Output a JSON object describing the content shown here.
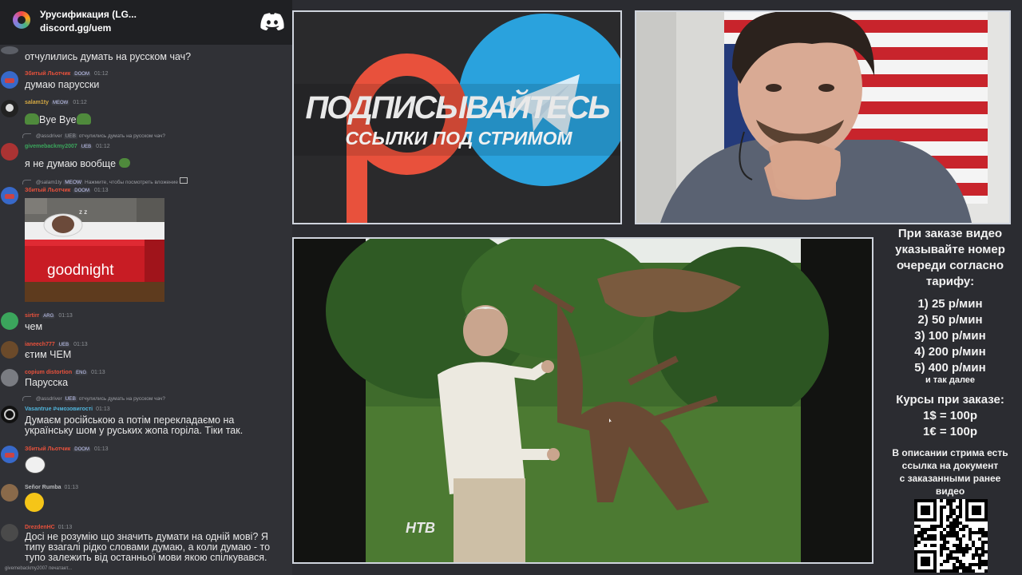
{
  "chat": {
    "server": {
      "name": "Урусификация (LG...",
      "invite": "discord.gg/uem",
      "discord_icon": "discord-logo-icon"
    },
    "messages": [
      {
        "text": "отчулились думать на русском чач?"
      },
      {
        "author": "Збитый Льотчик",
        "author_color": "#e8513c",
        "badge": "DOOM",
        "time": "01:12",
        "text": "думаю парусски"
      },
      {
        "author": "salam1ty",
        "author_color": "#d4a843",
        "badge": "MEOW",
        "time": "01:12",
        "text": "Bye Bye"
      },
      {
        "reply_to": "@assdriver",
        "reply_badge": "UEB",
        "reply_text": "отчулились думать на русском чач?",
        "author": "givemebackmy2007",
        "author_color": "#3ba55c",
        "badge": "UEB",
        "time": "01:12",
        "text": "я не думаю вообще"
      },
      {
        "reply_to": "@salam1ty",
        "reply_badge": "MEOW",
        "reply_text": "Нажмите, чтобы посмотреть вложение",
        "author": "Збитый Льотчик",
        "author_color": "#e8513c",
        "badge": "DOOM",
        "time": "01:13",
        "image_caption": "goodnight"
      },
      {
        "author": "sirtirr",
        "author_color": "#e8513c",
        "badge": "ARG",
        "time": "01:13",
        "text": "чем"
      },
      {
        "author": "ianeech777",
        "author_color": "#e8513c",
        "badge": "UEB",
        "time": "01:13",
        "text": "єтим ЧЕМ"
      },
      {
        "author": "copium distortion",
        "author_color": "#e8513c",
        "badge": "ENG",
        "time": "01:13",
        "text": "Парусска"
      },
      {
        "reply_to": "@assdriver",
        "reply_badge": "UEB",
        "reply_text": "отчулились думать на русском чач?",
        "author": "Vasantrue #чмозовигості",
        "author_color": "#4fb3d9",
        "time": "01:13",
        "text_lines": [
          "Думаєм російською а потім перекладаємо на",
          "українську шом у руських жопа горіла. Тіки так."
        ]
      },
      {
        "author": "Збитый Льотчик",
        "author_color": "#e8513c",
        "badge": "DOOM",
        "time": "01:13"
      },
      {
        "author": "Señor Rumba",
        "author_color": "#b9bbbe",
        "time": "01:13"
      },
      {
        "author": "DrezdenHC",
        "author_color": "#e8513c",
        "time": "01:13",
        "text_lines": [
          "Досі не розумію що значить думати на одній мові? Я",
          "типу взагалі рідко словами думаю, а коли думаю - то",
          "тупо залежить від останньої мови якою спілкувався."
        ]
      }
    ],
    "typing": "givemebackmy2007 печатает..."
  },
  "promo": {
    "title": "ПОДПИСЫВАЙТЕСЬ",
    "subtitle": "ССЫЛКИ ПОД СТРИМОМ",
    "icons": [
      "patreon-logo-icon",
      "telegram-logo-icon"
    ]
  },
  "video": {
    "watermark": "НТВ"
  },
  "info": {
    "order_heading": "При заказе видео\nуказывайте номер\nочереди согласно\nтарифу:",
    "tariffs": [
      "1) 25 р/мин",
      "2) 50 р/мин",
      "3) 100 р/мин",
      "4) 200 р/мин",
      "5) 400 р/мин"
    ],
    "and_so_on": "и так далее",
    "courses_heading": "Курсы при заказе:",
    "courses": [
      "1$ = 100р",
      "1€ = 100р"
    ],
    "description_note": "В описании стрима есть\nссылка на документ\nс заказанными ранее\nвидео"
  },
  "colors": {
    "chat_bg": "#303136",
    "header_bg": "#1f2023",
    "frame_border": "#cfd4dd",
    "telegram_blue": "#2aa2dd",
    "patreon_red": "#e8513c"
  }
}
